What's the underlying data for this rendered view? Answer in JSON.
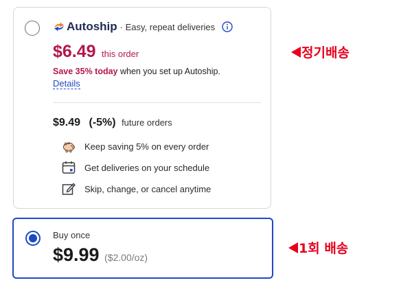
{
  "autoship_option": {
    "brand_name": "Autoship",
    "tagline": "· Easy, repeat deliveries",
    "price": "$6.49",
    "price_note": "this order",
    "save_highlight": "Save 35% today",
    "save_rest": " when you set up Autoship.",
    "details_link": "Details",
    "future_price": "$9.49",
    "future_discount": "(-5%)",
    "future_label": "future orders",
    "benefits": [
      {
        "icon": "piggy-bank-icon",
        "text": "Keep saving 5% on every order"
      },
      {
        "icon": "calendar-icon",
        "text": "Get deliveries on your schedule"
      },
      {
        "icon": "edit-icon",
        "text": "Skip, change, or cancel anytime"
      }
    ],
    "selected": false
  },
  "buy_once_option": {
    "label": "Buy once",
    "price": "$9.99",
    "unit_price": "($2.00/oz)",
    "selected": true
  },
  "annotations": {
    "autoship_label": "정기배송",
    "buy_once_label": "1회 배송"
  },
  "colors": {
    "accent": "#1c49c2",
    "sale": "#b3174b",
    "annotation": "#e8001c",
    "brand_orange": "#f47a20"
  }
}
